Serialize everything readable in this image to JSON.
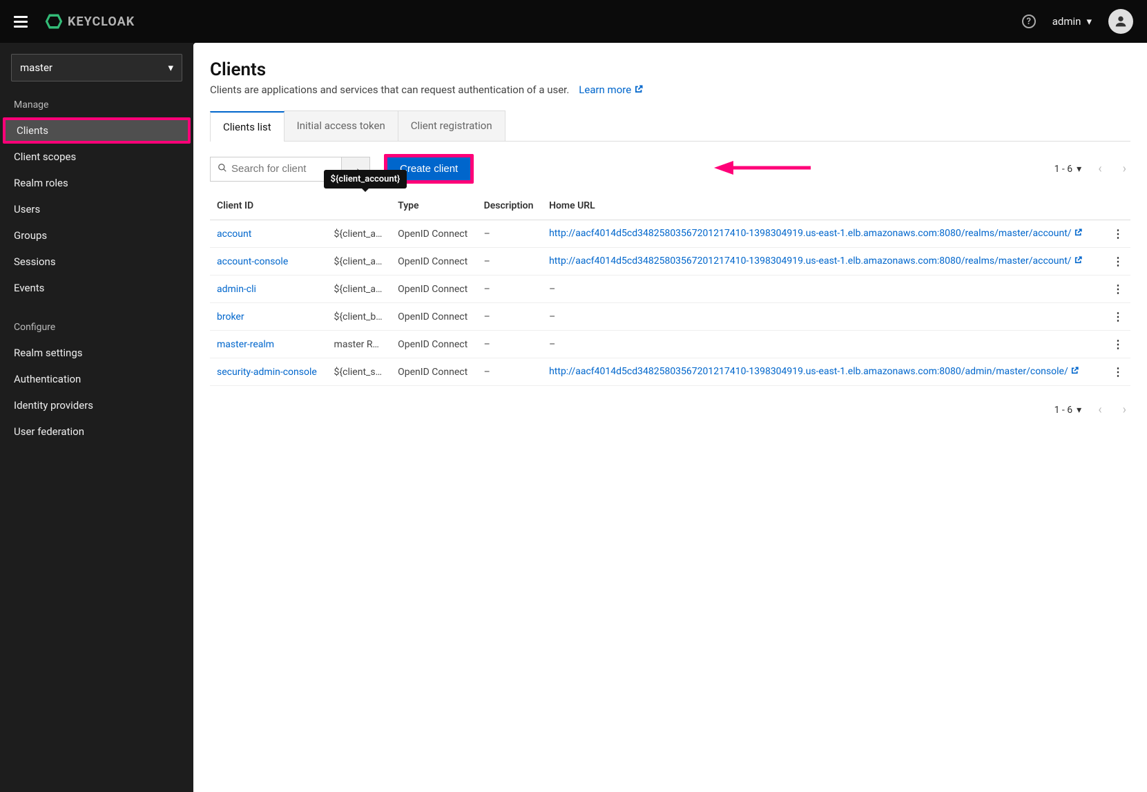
{
  "header": {
    "logo_text": "KEYCLOAK",
    "user_label": "admin"
  },
  "sidebar": {
    "realm": "master",
    "section_manage": "Manage",
    "section_configure": "Configure",
    "items_manage": [
      {
        "label": "Clients",
        "active": true
      },
      {
        "label": "Client scopes"
      },
      {
        "label": "Realm roles"
      },
      {
        "label": "Users"
      },
      {
        "label": "Groups"
      },
      {
        "label": "Sessions"
      },
      {
        "label": "Events"
      }
    ],
    "items_configure": [
      {
        "label": "Realm settings"
      },
      {
        "label": "Authentication"
      },
      {
        "label": "Identity providers"
      },
      {
        "label": "User federation"
      }
    ]
  },
  "page": {
    "title": "Clients",
    "description": "Clients are applications and services that can request authentication of a user.",
    "learn_more": "Learn more"
  },
  "tabs": [
    {
      "label": "Clients list",
      "active": true
    },
    {
      "label": "Initial access token"
    },
    {
      "label": "Client registration"
    }
  ],
  "toolbar": {
    "search_placeholder": "Search for client",
    "create_label": "Create client",
    "range": "1 - 6"
  },
  "tooltip_text": "${client_account}",
  "table": {
    "headers": [
      "Client ID",
      "",
      "Type",
      "Description",
      "Home URL"
    ],
    "rows": [
      {
        "id": "account",
        "name": "${client_acc...",
        "type": "OpenID Connect",
        "desc": "–",
        "url": "http://aacf4014d5cd34825803567201217410-1398304919.us-east-1.elb.amazonaws.com:8080/realms/master/account/"
      },
      {
        "id": "account-console",
        "name": "${client_acc...",
        "type": "OpenID Connect",
        "desc": "–",
        "url": "http://aacf4014d5cd34825803567201217410-1398304919.us-east-1.elb.amazonaws.com:8080/realms/master/account/"
      },
      {
        "id": "admin-cli",
        "name": "${client_ad...",
        "type": "OpenID Connect",
        "desc": "–",
        "url": "–"
      },
      {
        "id": "broker",
        "name": "${client_bro...",
        "type": "OpenID Connect",
        "desc": "–",
        "url": "–"
      },
      {
        "id": "master-realm",
        "name": "master Realm",
        "type": "OpenID Connect",
        "desc": "–",
        "url": "–"
      },
      {
        "id": "security-admin-console",
        "name": "${client_sec...",
        "type": "OpenID Connect",
        "desc": "–",
        "url": "http://aacf4014d5cd34825803567201217410-1398304919.us-east-1.elb.amazonaws.com:8080/admin/master/console/"
      }
    ]
  }
}
